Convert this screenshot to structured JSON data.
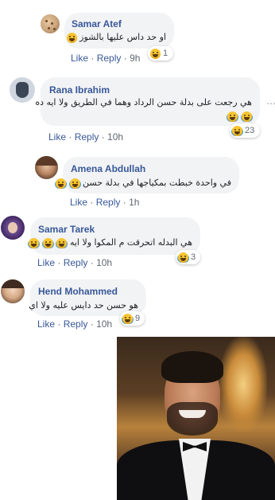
{
  "comments": [
    {
      "author": "Samar Atef",
      "text": "او حد داس عليها بالشوز",
      "emoji_count_text": 1,
      "like": "Like",
      "reply": "Reply",
      "time": "9h",
      "reaction_count": "1",
      "avatar_icon": "cookie-avatar"
    },
    {
      "author": "Rana Ibrahim",
      "text": "هي رجعت على بدلة حسن الرداد وهما في الطريق ولا ايه ده",
      "like": "Like",
      "reply": "Reply",
      "time": "10h",
      "reaction_count": "23",
      "avatar_icon": "hand-avatar"
    },
    {
      "author": "Amena Abdullah",
      "text": "في واحدة خبطت بمكياجها في بدلة حسن",
      "like": "Like",
      "reply": "Reply",
      "time": "1h",
      "avatar_icon": "woman-avatar"
    },
    {
      "author": "Samar Tarek",
      "text": "هي البدله اتحرقت م المكوا ولا ايه",
      "like": "Like",
      "reply": "Reply",
      "time": "10h",
      "reaction_count": "3",
      "avatar_icon": "girl-avatar"
    },
    {
      "author": "Hend Mohammed",
      "text": "هو حسن حد دايس عليه ولا اي",
      "like": "Like",
      "reply": "Reply",
      "time": "10h",
      "reaction_count": "9",
      "avatar_icon": "woman-avatar"
    }
  ],
  "separator": "·",
  "more_icon": "⋯",
  "colors": {
    "link": "#385898",
    "bubble": "#f2f3f5",
    "meta": "#606770",
    "emoji": "#f7c531"
  }
}
